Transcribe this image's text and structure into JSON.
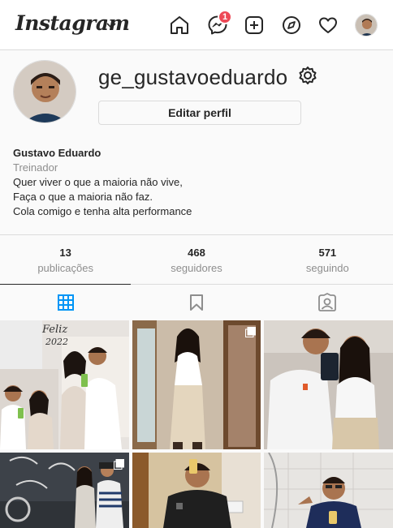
{
  "app": {
    "logo_text": "Instagram",
    "notification_count": "1",
    "brand_badge_color": "#ed4956",
    "icons": [
      "chevron-down-icon",
      "home-icon",
      "messenger-icon",
      "new-post-icon",
      "explore-icon",
      "heart-icon"
    ]
  },
  "profile": {
    "username": "ge_gustavoeduardo",
    "edit_label": "Editar perfil",
    "full_name": "Gustavo Eduardo",
    "category": "Treinador",
    "bio_lines": [
      "Quer viver o que a maioria não vive,",
      "Faça o que a maioria não faz.",
      "Cola comigo e tenha alta performance"
    ]
  },
  "stats": [
    {
      "value": "13",
      "label": "publicações"
    },
    {
      "value": "468",
      "label": "seguidores"
    },
    {
      "value": "571",
      "label": "seguindo"
    }
  ],
  "tabs": [
    {
      "icon": "grid-icon",
      "active": true,
      "color": "#0095f6"
    },
    {
      "icon": "bookmark-icon",
      "active": false
    },
    {
      "icon": "tagged-icon",
      "active": false
    }
  ],
  "posts": [
    {
      "overlay_text": "Feliz",
      "overlay_text_2": "2022",
      "multi": false
    },
    {
      "multi": true
    },
    {
      "multi": false
    },
    {
      "multi": true
    },
    {
      "multi": false
    },
    {
      "multi": false
    }
  ]
}
